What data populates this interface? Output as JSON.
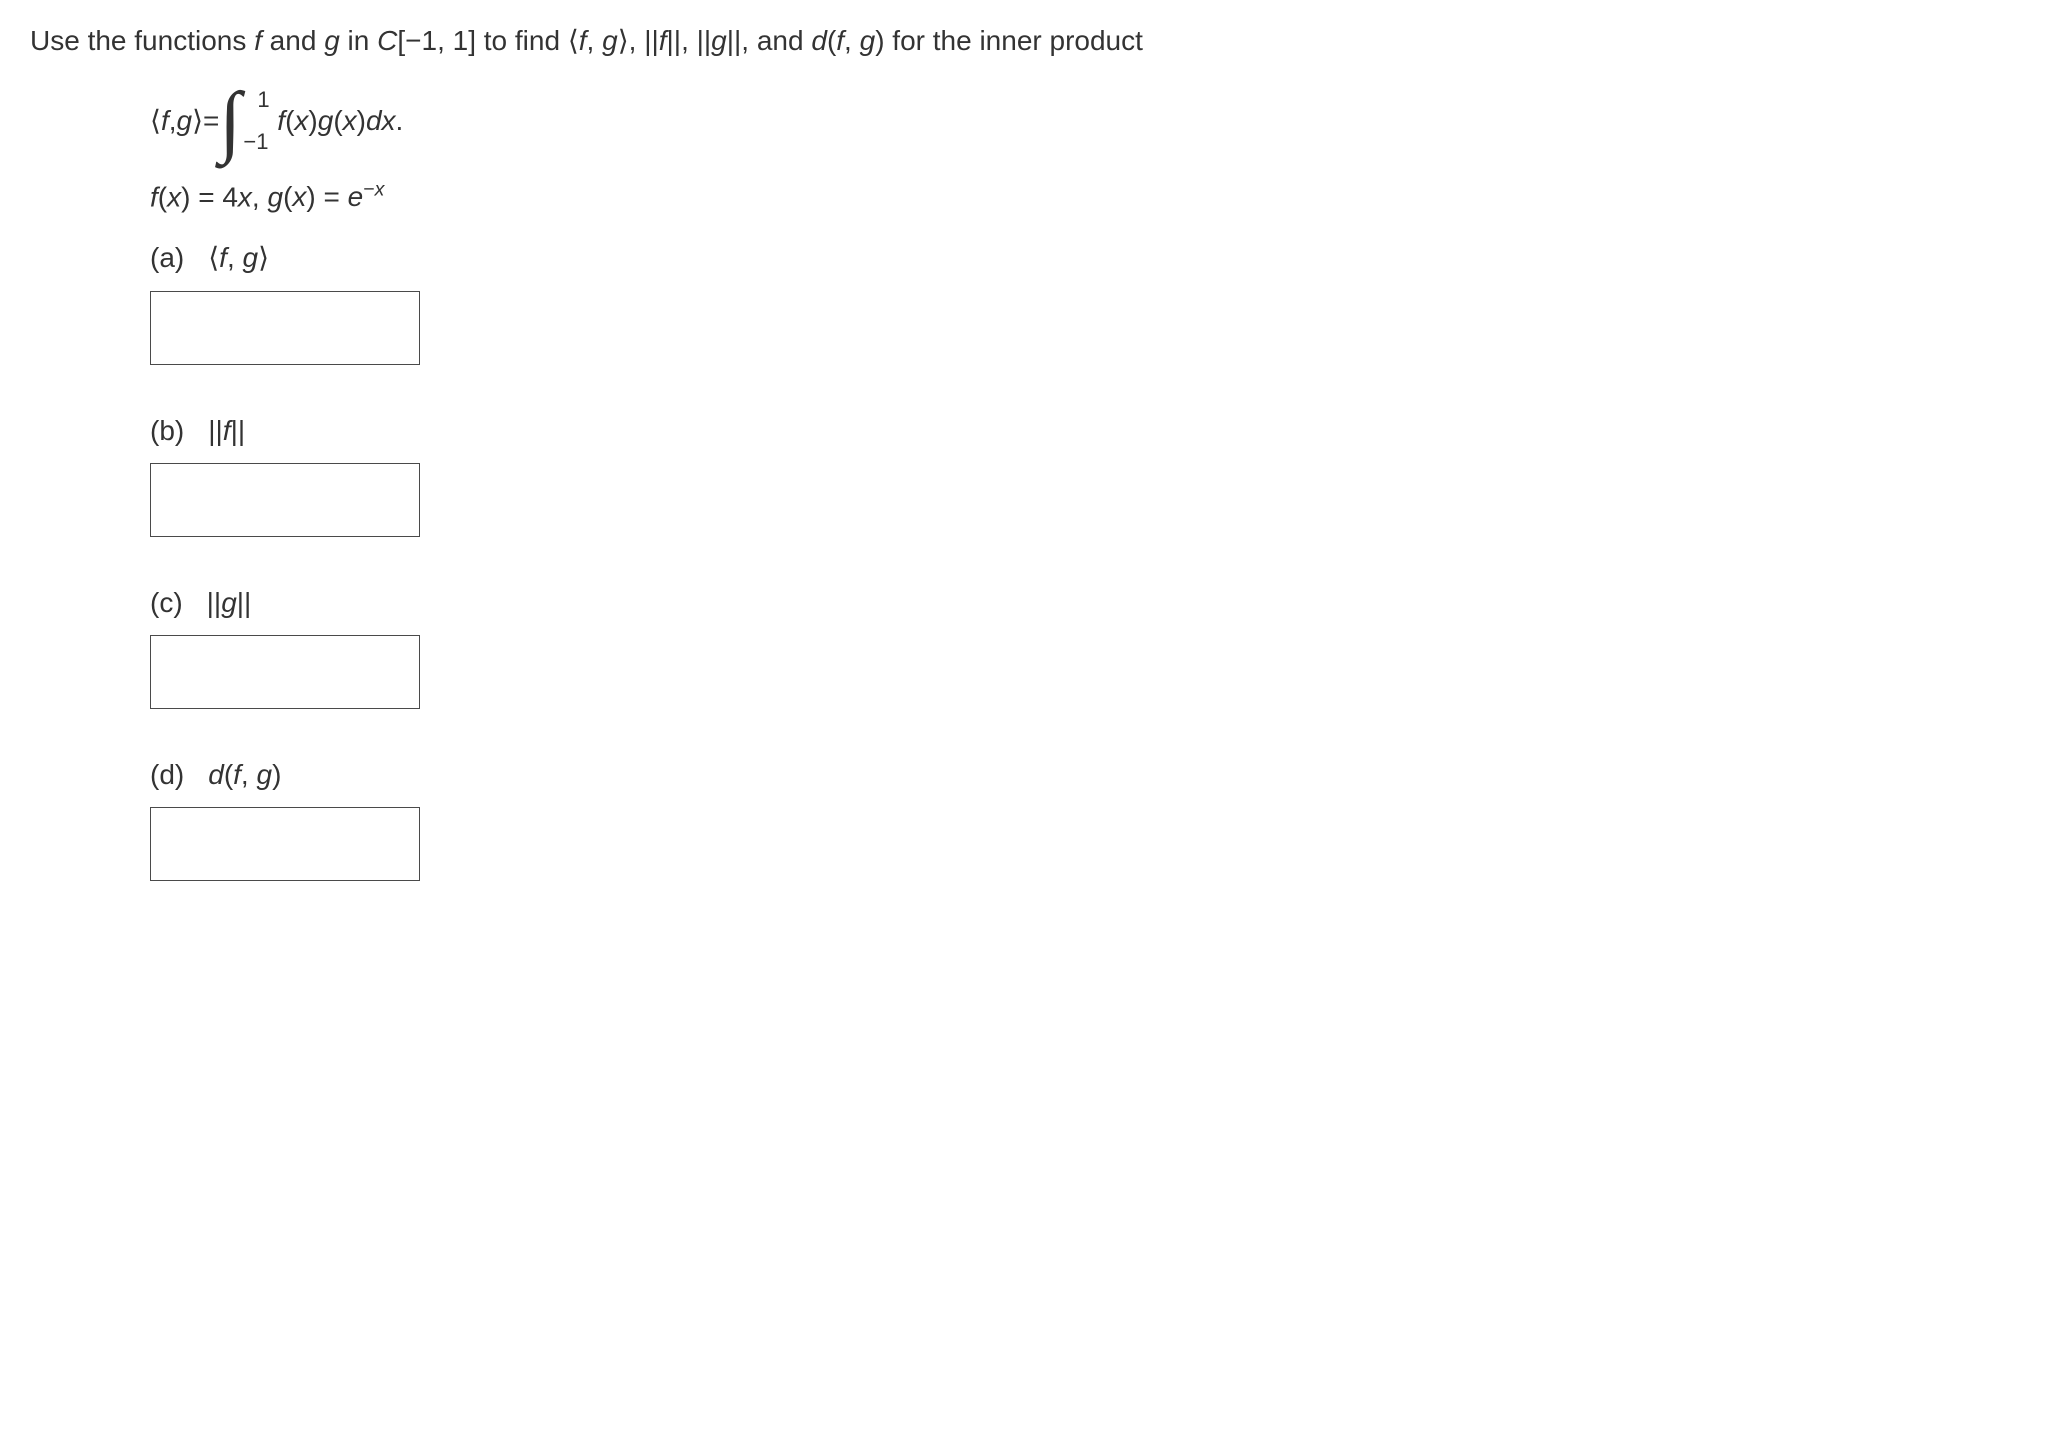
{
  "intro": {
    "pre": "Use the functions ",
    "f": "f",
    "and": " and ",
    "g": "g",
    "in": "  in ",
    "C": "C",
    "range": "[−1, 1]",
    "tofind": " to find ",
    "fg_open": "⟨",
    "fg_f": "f",
    "fg_comma": ", ",
    "fg_g": "g",
    "fg_close": "⟩",
    "sep1": ", ",
    "nf": "||f||",
    "sep2": ", ",
    "ng": "||g||",
    "sep3": ", and ",
    "d": "d",
    "dfg": "(f, g)",
    "tail": "  for the inner product"
  },
  "formula": {
    "lhs_open": "⟨",
    "lhs_f": "f",
    "lhs_comma": ", ",
    "lhs_g": "g",
    "lhs_close": "⟩",
    "eq": " = ",
    "upper": "1",
    "lower": "−1",
    "fx": "f",
    "paren1": "(",
    "x1": "x",
    "paren2": ")",
    "gx": "g",
    "paren3": "(",
    "x2": "x",
    "paren4": ")",
    "dx": "dx",
    "dot": "."
  },
  "funcs": {
    "f": "f",
    "fx_paren": "(x) = 4x,",
    "spacer": "   ",
    "g": "g",
    "gx_paren": "(x) = e",
    "exp": "−x"
  },
  "parts": {
    "a": {
      "label": "(a)",
      "expr_open": "⟨",
      "expr_f": "f",
      "expr_comma": ", ",
      "expr_g": "g",
      "expr_close": "⟩"
    },
    "b": {
      "label": "(b)",
      "open": "||",
      "f": "f",
      "close": "||"
    },
    "c": {
      "label": "(c)",
      "open": "||",
      "g": "g",
      "close": "||"
    },
    "d": {
      "label": "(d)",
      "d": "d",
      "paren": "(f, g)"
    }
  }
}
